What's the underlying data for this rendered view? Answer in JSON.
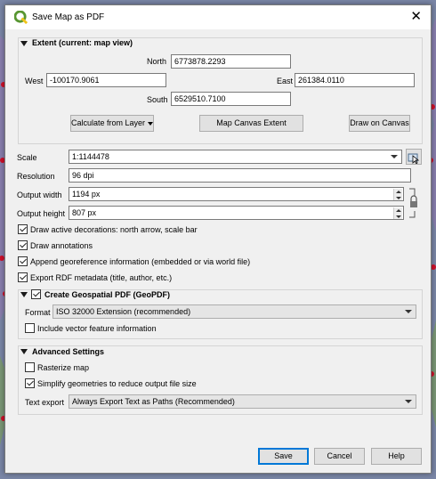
{
  "window": {
    "title": "Save Map as PDF"
  },
  "extent": {
    "header": "Extent (current: map view)",
    "north_label": "North",
    "north_value": "6773878.2293",
    "west_label": "West",
    "west_value": "-100170.9061",
    "east_label": "East",
    "east_value": "261384.0110",
    "south_label": "South",
    "south_value": "6529510.7100",
    "calc_button": "Calculate from Layer",
    "canvas_button": "Map Canvas Extent",
    "draw_button": "Draw on Canvas"
  },
  "settings": {
    "scale_label": "Scale",
    "scale_value": "1:1144478",
    "resolution_label": "Resolution",
    "resolution_value": "96 dpi",
    "width_label": "Output width",
    "width_value": "1194 px",
    "height_label": "Output height",
    "height_value": "807 px"
  },
  "options": {
    "decorations": "Draw active decorations: north arrow, scale bar",
    "annotations": "Draw annotations",
    "georef": "Append georeference information (embedded or via world file)",
    "rdf": "Export RDF metadata (title, author, etc.)"
  },
  "geopdf": {
    "header": "Create Geospatial PDF (GeoPDF)",
    "format_label": "Format",
    "format_value": "ISO 32000 Extension (recommended)",
    "vector_info": "Include vector feature information"
  },
  "advanced": {
    "header": "Advanced Settings",
    "rasterize": "Rasterize map",
    "simplify": "Simplify geometries to reduce output file size",
    "text_export_label": "Text export",
    "text_export_value": "Always Export Text as Paths (Recommended)"
  },
  "footer": {
    "save": "Save",
    "cancel": "Cancel",
    "help": "Help"
  },
  "colors": {
    "accent": "#0078d7",
    "qgis_green": "#589632",
    "qgis_yellow": "#f0c419"
  }
}
